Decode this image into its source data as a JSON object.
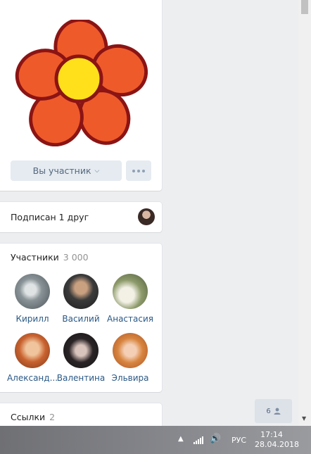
{
  "group": {
    "member_button": "Вы участник",
    "more_button_icon": "more-dots-icon"
  },
  "friends": {
    "label": "Подписан 1 друг"
  },
  "members": {
    "title": "Участники",
    "count": "3 000",
    "items": [
      {
        "name": "Кирилл"
      },
      {
        "name": "Василий"
      },
      {
        "name": "Анастасия"
      },
      {
        "name": "Александ..."
      },
      {
        "name": "Валентина"
      },
      {
        "name": "Эльвира"
      }
    ]
  },
  "links": {
    "title": "Ссылки",
    "count": "2"
  },
  "online": {
    "count": "6",
    "icon": "person-icon"
  },
  "taskbar": {
    "language": "РУС",
    "time": "17:14",
    "date": "28.04.2018"
  },
  "colors": {
    "page_bg": "#edeef0",
    "link": "#2a5885",
    "button_bg": "#e5ebf1"
  }
}
